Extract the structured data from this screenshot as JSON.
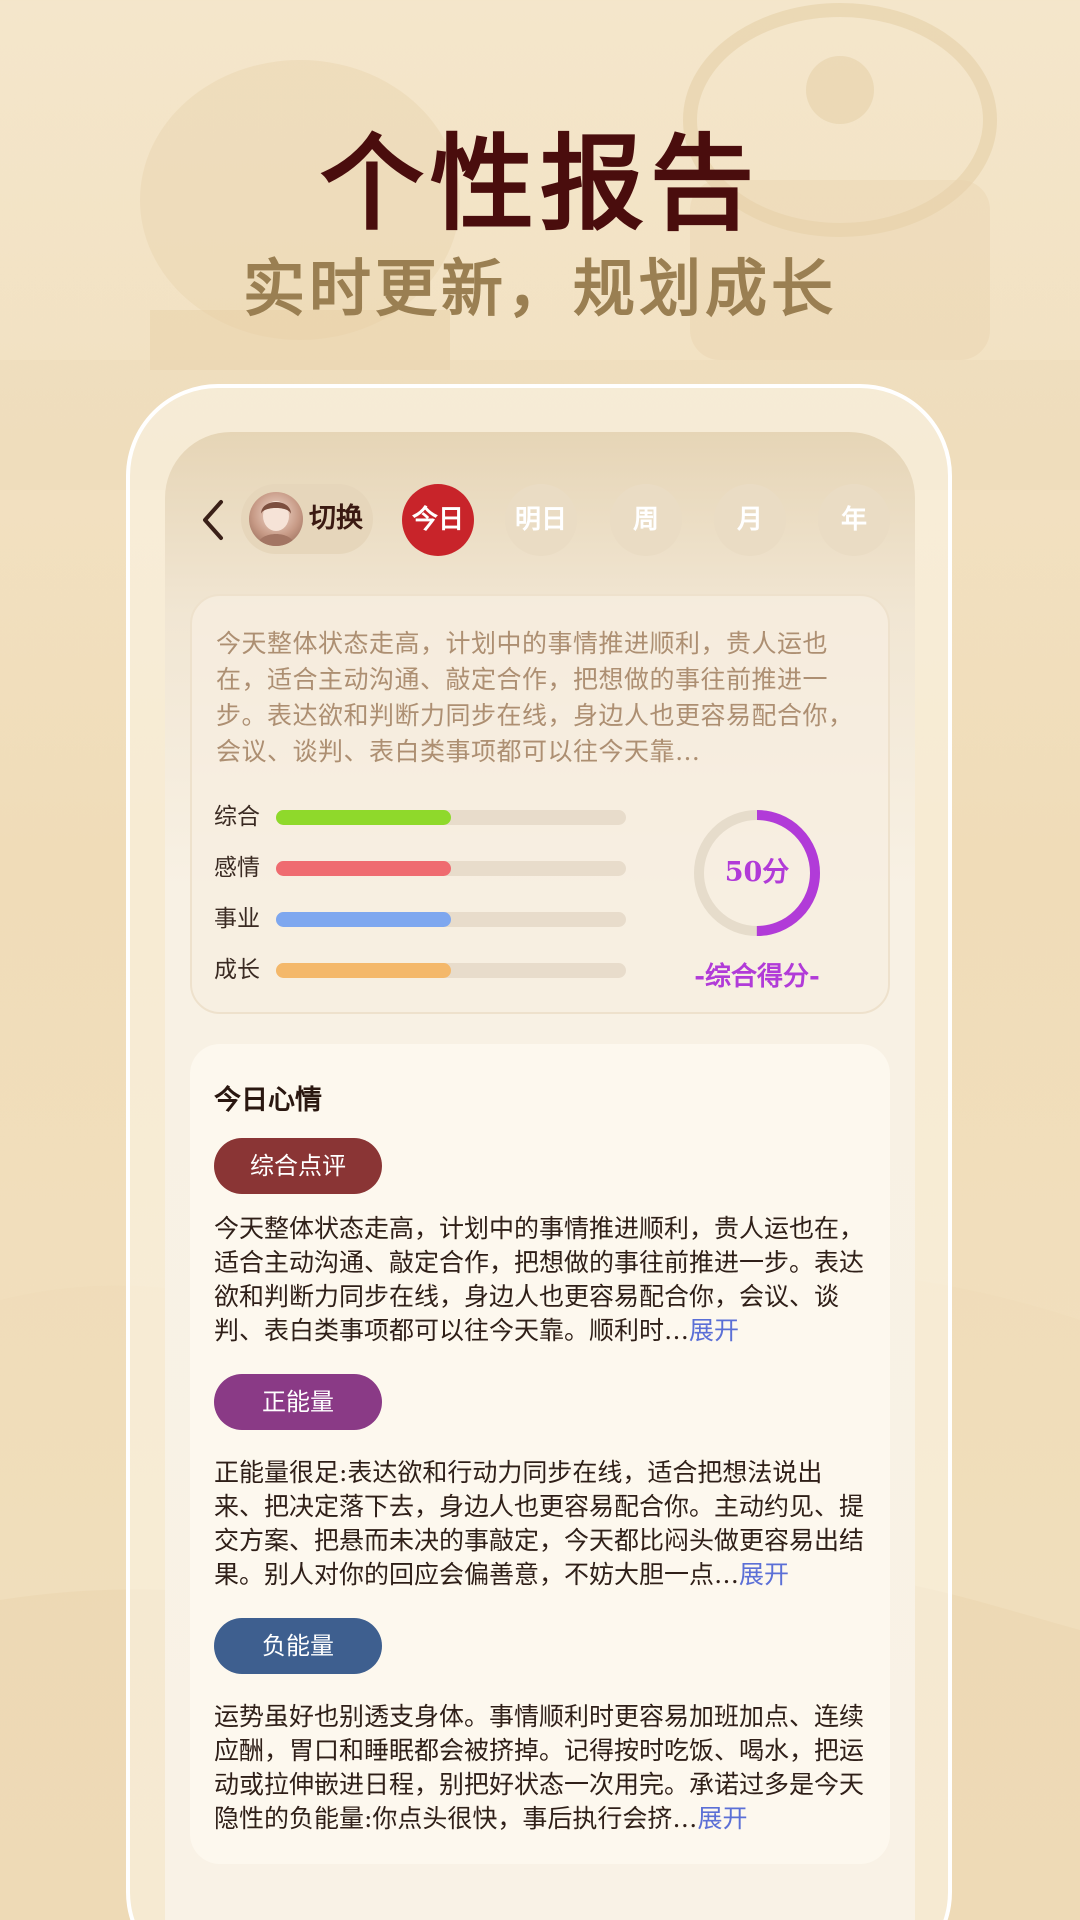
{
  "promo": {
    "title": "个性报告",
    "subtitle": "实时更新，规划成长"
  },
  "topbar": {
    "switch_label": "切换",
    "tabs": [
      {
        "label": "今日",
        "active": true
      },
      {
        "label": "明日",
        "active": false
      },
      {
        "label": "周",
        "active": false
      },
      {
        "label": "月",
        "active": false
      },
      {
        "label": "年",
        "active": false
      }
    ]
  },
  "summary": {
    "text": "今天整体状态走高，计划中的事情推进顺利，贵人运也在，适合主动沟通、敲定合作，把想做的事往前推进一步。表达欲和判断力同步在线，身边人也更容易配合你，会议、谈判、表白类事项都可以往今天靠…",
    "scores": [
      {
        "label": "综合",
        "value": 0.5,
        "color": "#8fd92b"
      },
      {
        "label": "感情",
        "value": 0.5,
        "color": "#ef6b70"
      },
      {
        "label": "事业",
        "value": 0.5,
        "color": "#7ea7ef"
      },
      {
        "label": "成长",
        "value": 0.5,
        "color": "#f4b86a"
      }
    ],
    "overall": {
      "value_text": "50分",
      "value": 50,
      "max": 100,
      "caption": "-综合得分-",
      "color": "#b13bd8"
    }
  },
  "detail": {
    "title": "今日心情",
    "expand_label": "展开",
    "sections": [
      {
        "pill": "综合点评",
        "pill_color": "#8a3535",
        "text": "今天整体状态走高，计划中的事情推进顺利，贵人运也在，适合主动沟通、敲定合作，把想做的事往前推进一步。表达欲和判断力同步在线，身边人也更容易配合你，会议、谈判、表白类事项都可以往今天靠。顺利时…"
      },
      {
        "pill": "正能量",
        "pill_color": "#8a3a86",
        "text": "正能量很足:表达欲和行动力同步在线，适合把想法说出来、把决定落下去，身边人也更容易配合你。主动约见、提交方案、把悬而未决的事敲定，今天都比闷头做更容易出结果。别人对你的回应会偏善意，不妨大胆一点…"
      },
      {
        "pill": "负能量",
        "pill_color": "#3e5f8f",
        "text": "运势虽好也别透支身体。事情顺利时更容易加班加点、连续应酬，胃口和睡眠都会被挤掉。记得按时吃饭、喝水，把运动或拉伸嵌进日程，别把好状态一次用完。承诺过多是今天隐性的负能量:你点头很快，事后执行会挤…"
      }
    ]
  }
}
